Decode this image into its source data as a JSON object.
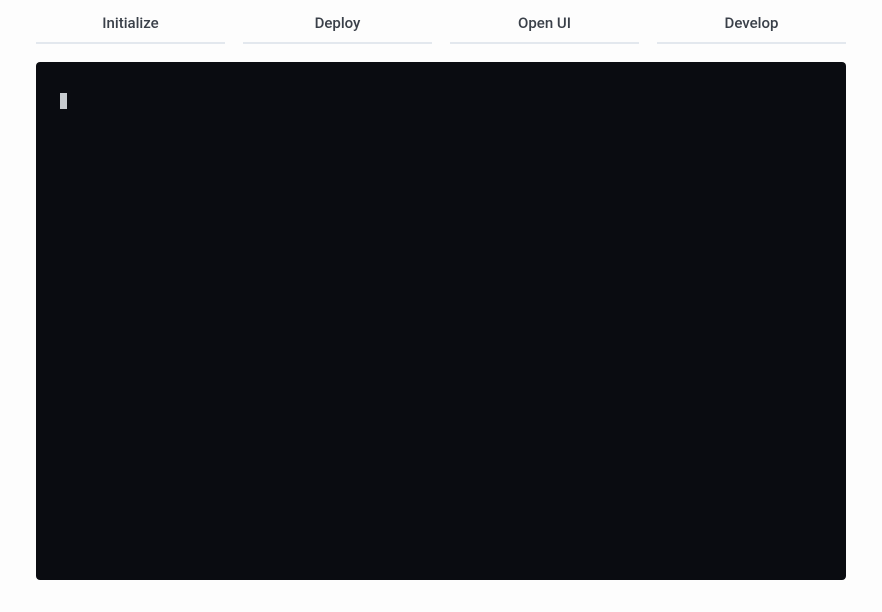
{
  "tabs": [
    {
      "label": "Initialize"
    },
    {
      "label": "Deploy"
    },
    {
      "label": "Open UI"
    },
    {
      "label": "Develop"
    }
  ],
  "terminal": {
    "content": ""
  }
}
